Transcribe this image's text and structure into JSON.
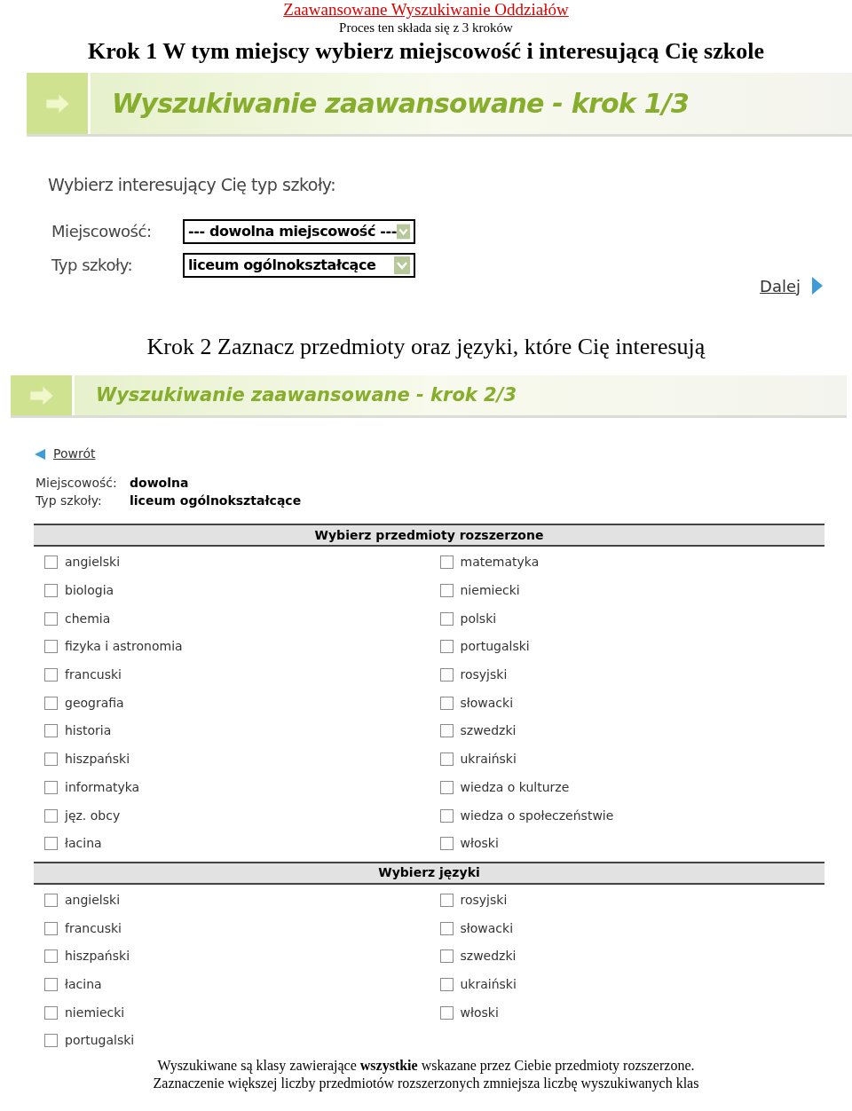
{
  "doc_title": "Zaawansowane Wyszukiwanie Oddziałów",
  "doc_subtitle": "Proces ten składa się z 3 kroków",
  "step1_heading": "Krok 1 W tym miejscy wybierz miejscowość i interesującą Cię szkole",
  "step1": {
    "banner": "Wyszukiwanie zaawansowane - krok 1/3",
    "prompt": "Wybierz interesujący Cię typ szkoły:",
    "fields": [
      {
        "label": "Miejscowość:",
        "value": "--- dowolna miejscowość ---"
      },
      {
        "label": "Typ szkoły:",
        "value": "liceum ogólnokształcące"
      }
    ],
    "next_link": "Dalej"
  },
  "step2_heading": "Krok 2 Zaznacz przedmioty oraz języki, które Cię interesują",
  "step2": {
    "banner": "Wyszukiwanie zaawansowane - krok 2/3",
    "back_link": "Powrót",
    "summary": [
      {
        "label": "Miejscowość:",
        "value": "dowolna"
      },
      {
        "label": "Typ szkoły:",
        "value": "liceum ogólnokształcące"
      }
    ],
    "sections": [
      {
        "title": "Wybierz przedmioty rozszerzone",
        "columns": [
          [
            {
              "label": "angielski",
              "checked": false
            },
            {
              "label": "biologia",
              "checked": false
            },
            {
              "label": "chemia",
              "checked": false
            },
            {
              "label": "fizyka i astronomia",
              "checked": false
            },
            {
              "label": "francuski",
              "checked": false
            },
            {
              "label": "geografia",
              "checked": false
            },
            {
              "label": "historia",
              "checked": false
            },
            {
              "label": "hiszpański",
              "checked": false
            },
            {
              "label": "informatyka",
              "checked": false
            },
            {
              "label": "jęz. obcy",
              "checked": false
            },
            {
              "label": "łacina",
              "checked": false
            }
          ],
          [
            {
              "label": "matematyka",
              "checked": false
            },
            {
              "label": "niemiecki",
              "checked": false
            },
            {
              "label": "polski",
              "checked": false
            },
            {
              "label": "portugalski",
              "checked": false
            },
            {
              "label": "rosyjski",
              "checked": false
            },
            {
              "label": "słowacki",
              "checked": false
            },
            {
              "label": "szwedzki",
              "checked": false
            },
            {
              "label": "ukraiński",
              "checked": false
            },
            {
              "label": "wiedza o kulturze",
              "checked": false
            },
            {
              "label": "wiedza o społeczeństwie",
              "checked": false
            },
            {
              "label": "włoski",
              "checked": false
            }
          ]
        ]
      },
      {
        "title": "Wybierz języki",
        "columns": [
          [
            {
              "label": "angielski",
              "checked": false
            },
            {
              "label": "francuski",
              "checked": false
            },
            {
              "label": "hiszpański",
              "checked": false
            },
            {
              "label": "łacina",
              "checked": false
            },
            {
              "label": "niemiecki",
              "checked": false
            },
            {
              "label": "portugalski",
              "checked": false
            }
          ],
          [
            {
              "label": "rosyjski",
              "checked": false
            },
            {
              "label": "słowacki",
              "checked": false
            },
            {
              "label": "szwedzki",
              "checked": false
            },
            {
              "label": "ukraiński",
              "checked": false
            },
            {
              "label": "włoski",
              "checked": false
            }
          ]
        ]
      }
    ]
  },
  "footer_notes": [
    "Wyszukiwane są klasy zawierające **wszystkie** wskazane przez Ciebie przedmioty rozszerzone.",
    "Zaznaczenie większej liczby przedmiotów rozszerzonych zmniejsza liczbę wyszukiwanych klas"
  ]
}
